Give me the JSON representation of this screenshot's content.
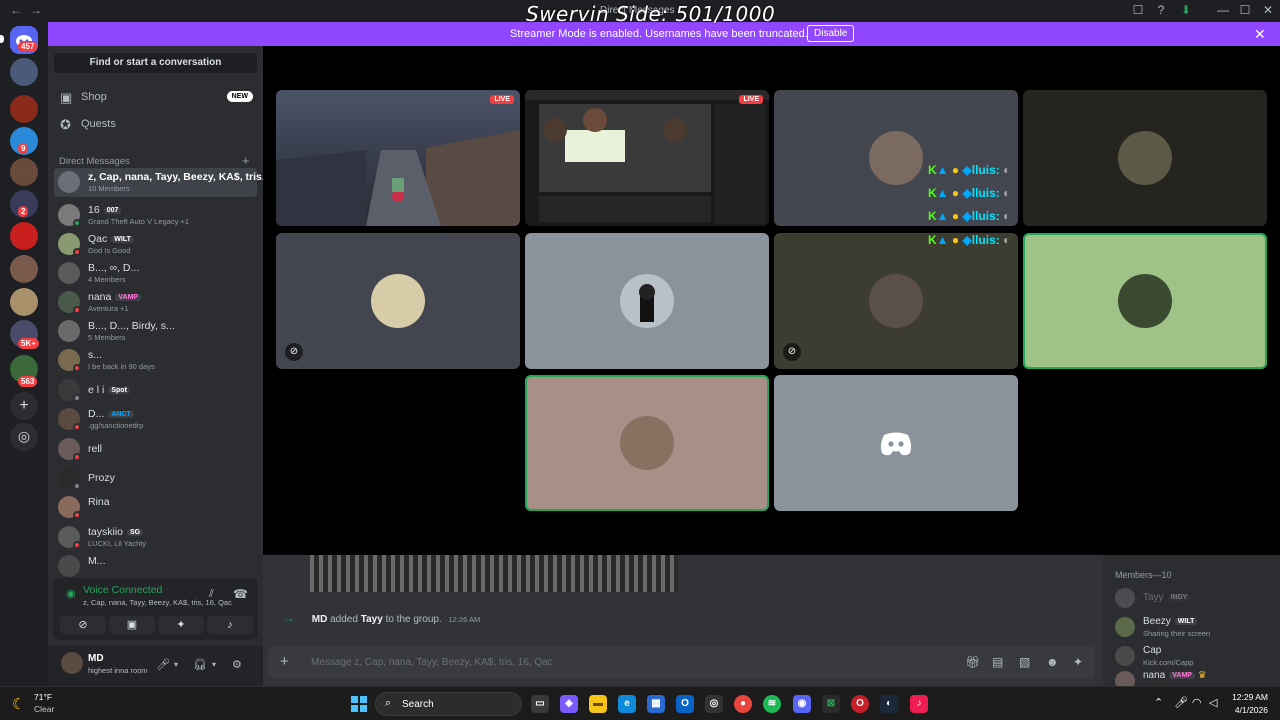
{
  "window": {
    "title": "Direct Messages",
    "overlay_text": "Swervin Side: 501/1000",
    "back": "←",
    "forward": "→",
    "controls": [
      "☐",
      "?",
      "⬇",
      "—",
      "☐",
      "✕"
    ]
  },
  "banner": {
    "message": "Streamer Mode is enabled. Usernames have been truncated.",
    "button": "Disable",
    "close": "✕",
    "color": "#9147ff"
  },
  "rail": {
    "home_badge": "457",
    "badges": [
      "9",
      "2",
      "5K+",
      "563"
    ],
    "add_server": "+",
    "discover": "◎"
  },
  "sidebar": {
    "find_placeholder": "Find or start a conversation",
    "shop": {
      "label": "Shop",
      "badge": "NEW",
      "icon": "shop-icon"
    },
    "quests": {
      "label": "Quests",
      "icon": "quests-icon"
    },
    "dm_header": "Direct Messages",
    "dm_add": "+",
    "dms": [
      {
        "name": "z, Cap, nana, Tayy, Beezy, KA$, tris...",
        "sub": "10 Members",
        "tag": "",
        "active": true
      },
      {
        "name": "16",
        "tag": "007",
        "sub": "Grand Theft Auto V Legacy +1"
      },
      {
        "name": "Qac",
        "tag": "WILT",
        "sub": "God Is Good"
      },
      {
        "name": "B..., ∞, D...",
        "tag": "",
        "sub": "4 Members"
      },
      {
        "name": "nana",
        "tag": "VAMP",
        "sub": "Aventura +1"
      },
      {
        "name": "B..., D..., Birdy, s...",
        "tag": "",
        "sub": "5 Members"
      },
      {
        "name": "s...",
        "tag": "",
        "sub": "I be back in 90 days"
      },
      {
        "name": "e l i",
        "tag": "Spot",
        "sub": ""
      },
      {
        "name": "D...",
        "tag": "ANCT",
        "sub": ".gg/sanctionedrp"
      },
      {
        "name": "rell",
        "tag": "",
        "sub": ""
      },
      {
        "name": "Prozy",
        "tag": "",
        "sub": ""
      },
      {
        "name": "Rina",
        "tag": "",
        "sub": ""
      },
      {
        "name": "tayskiio",
        "tag": "SG",
        "sub": "LUCKI, Lil Yachty"
      },
      {
        "name": "M...",
        "tag": "",
        "sub": ""
      }
    ]
  },
  "voice": {
    "status": "Voice Connected",
    "channel": "z, Cap, nana, Tayy, Beezy, KA$, tris, 16, Qac",
    "buttons": [
      "camera-off",
      "screen-share",
      "activities",
      "soundboard"
    ]
  },
  "user": {
    "name": "MD",
    "status": "highest inna room"
  },
  "call": {
    "live_label": "LIVE",
    "kick_label": "lluis:"
  },
  "chat": {
    "system_message": {
      "actor": "MD",
      "verb": "added",
      "target": "Tayy",
      "suffix": "to the group.",
      "time": "12:26 AM"
    },
    "composer_placeholder": "Message z, Cap, nana, Tayy, Beezy, KA$, tris, 16, Qac",
    "composer_plus": "+"
  },
  "members": {
    "header": "Members—10",
    "list": [
      {
        "name": "Tayy",
        "tag": "INDY",
        "sub": "",
        "offline": true
      },
      {
        "name": "Beezy",
        "tag": "WILT",
        "sub": "Sharing their screen"
      },
      {
        "name": "Cap",
        "tag": "",
        "sub": "Kick.com/Capp"
      },
      {
        "name": "nana",
        "tag": "VAMP",
        "sub": ""
      }
    ]
  },
  "taskbar": {
    "weather_temp": "71°F",
    "weather_desc": "Clear",
    "search_label": "Search",
    "time": "12:29 AM",
    "date": "4/1/2026"
  }
}
